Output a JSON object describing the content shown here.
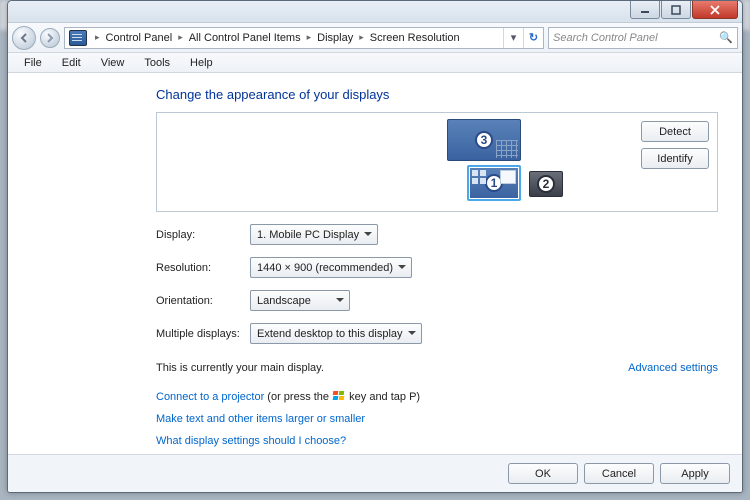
{
  "breadcrumb": {
    "items": [
      "Control Panel",
      "All Control Panel Items",
      "Display",
      "Screen Resolution"
    ]
  },
  "search": {
    "placeholder": "Search Control Panel"
  },
  "menu": {
    "file": "File",
    "edit": "Edit",
    "view": "View",
    "tools": "Tools",
    "help": "Help"
  },
  "page": {
    "title": "Change the appearance of your displays",
    "detect": "Detect",
    "identify": "Identify",
    "monitors": {
      "m1": "1",
      "m2": "2",
      "m3": "3"
    },
    "display_label": "Display:",
    "display_value": "1. Mobile PC Display",
    "resolution_label": "Resolution:",
    "resolution_value": "1440 × 900 (recommended)",
    "orientation_label": "Orientation:",
    "orientation_value": "Landscape",
    "multiple_label": "Multiple displays:",
    "multiple_value": "Extend desktop to this display",
    "main_display_text": "This is currently your main display.",
    "advanced": "Advanced settings",
    "projector_link": "Connect to a projector",
    "projector_hint": " (or press the ",
    "projector_hint2": " key and tap P)",
    "text_size_link": "Make text and other items larger or smaller",
    "help_link": "What display settings should I choose?"
  },
  "footer": {
    "ok": "OK",
    "cancel": "Cancel",
    "apply": "Apply"
  }
}
